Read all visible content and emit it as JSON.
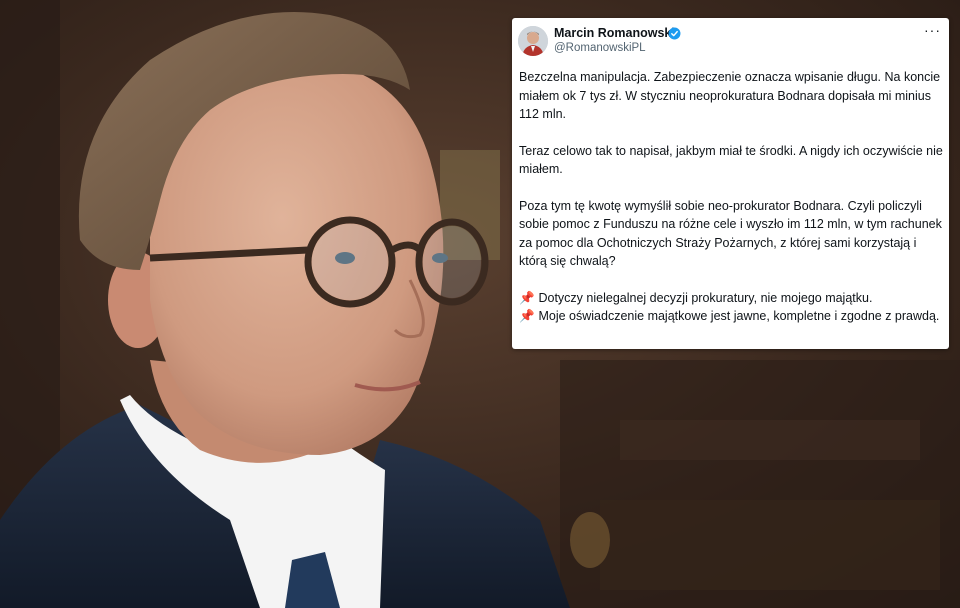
{
  "tweet": {
    "author_name": "Marcin Romanowski",
    "author_handle": "@RomanowskiPL",
    "more_label": "···",
    "paragraphs": [
      "Bezczelna manipulacja. Zabezpieczenie oznacza wpisanie długu. Na koncie miałem ok 7 tys zł. W styczniu neoprokuratura Bodnara dopisała mi minius 112 mln.",
      "Teraz celowo tak to napisał, jakbym miał te środki. A nigdy ich oczywiście nie miałem.",
      "Poza tym tę kwotę wymyślił sobie neo-prokurator Bodnara. Czyli policzyli sobie pomoc z Funduszu na różne cele i  wyszło im 112 mln, w tym rachunek za pomoc dla Ochotniczych Straży Pożarnych, z której sami korzystają i którą się chwalą?"
    ],
    "bullets": [
      "Dotyczy nielegalnej decyzji prokuratury, nie mojego majątku.",
      "Moje oświadczenie majątkowe jest jawne, kompletne i zgodne z prawdą."
    ],
    "bullet_icon": "pushpin-icon",
    "verified_color": "#1d9bf0"
  }
}
